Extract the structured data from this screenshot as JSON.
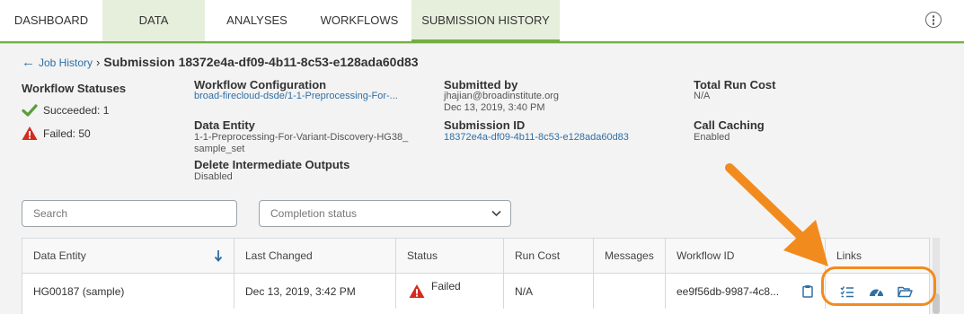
{
  "tabs": {
    "dashboard": "DASHBOARD",
    "data": "DATA",
    "analyses": "ANALYSES",
    "workflows": "WORKFLOWS",
    "submission_history": "SUBMISSION HISTORY"
  },
  "breadcrumb": {
    "back_label": "Job History",
    "separator": "›",
    "title": "Submission 18372e4a-df09-4b11-8c53-e128ada60d83"
  },
  "workflow_statuses": {
    "heading": "Workflow Statuses",
    "succeeded": "Succeeded: 1",
    "failed": "Failed: 50"
  },
  "details": {
    "workflow_configuration_label": "Workflow Configuration",
    "workflow_configuration_value": "broad-firecloud-dsde/1-1-Preprocessing-For-...",
    "data_entity_label": "Data Entity",
    "data_entity_value_line1": "1-1-Preprocessing-For-Variant-Discovery-HG38_",
    "data_entity_value_line2": "sample_set",
    "delete_outputs_label": "Delete Intermediate Outputs",
    "delete_outputs_value": "Disabled",
    "submitted_by_label": "Submitted by",
    "submitted_by_email": "jhajian@broadinstitute.org",
    "submitted_by_date": "Dec 13, 2019, 3:40 PM",
    "submission_id_label": "Submission ID",
    "submission_id_value": "18372e4a-df09-4b11-8c53-e128ada60d83",
    "total_cost_label": "Total Run Cost",
    "total_cost_value": "N/A",
    "call_caching_label": "Call Caching",
    "call_caching_value": "Enabled"
  },
  "filters": {
    "search_placeholder": "Search",
    "status_placeholder": "Completion status"
  },
  "table": {
    "headers": {
      "data_entity": "Data Entity",
      "last_changed": "Last Changed",
      "status": "Status",
      "run_cost": "Run Cost",
      "messages": "Messages",
      "workflow_id": "Workflow ID",
      "links": "Links"
    },
    "rows": [
      {
        "data_entity": "HG00187 (sample)",
        "last_changed": "Dec 13, 2019, 3:42 PM",
        "status": "Failed",
        "run_cost": "N/A",
        "messages": "",
        "workflow_id": "ee9f56db-9987-4c8..."
      }
    ]
  },
  "icons": [
    "arrow-left-icon",
    "check-icon",
    "warning-icon",
    "chevron-down-icon",
    "sort-arrow-down-icon",
    "clipboard-icon",
    "task-list-icon",
    "dashboard-gauge-icon",
    "folder-open-icon",
    "more-vertical-icon"
  ],
  "colors": {
    "accent_green": "#74ae43",
    "link_blue": "#2e6fa6",
    "error_red": "#d42b1f",
    "highlight_orange": "#f28b1e"
  }
}
